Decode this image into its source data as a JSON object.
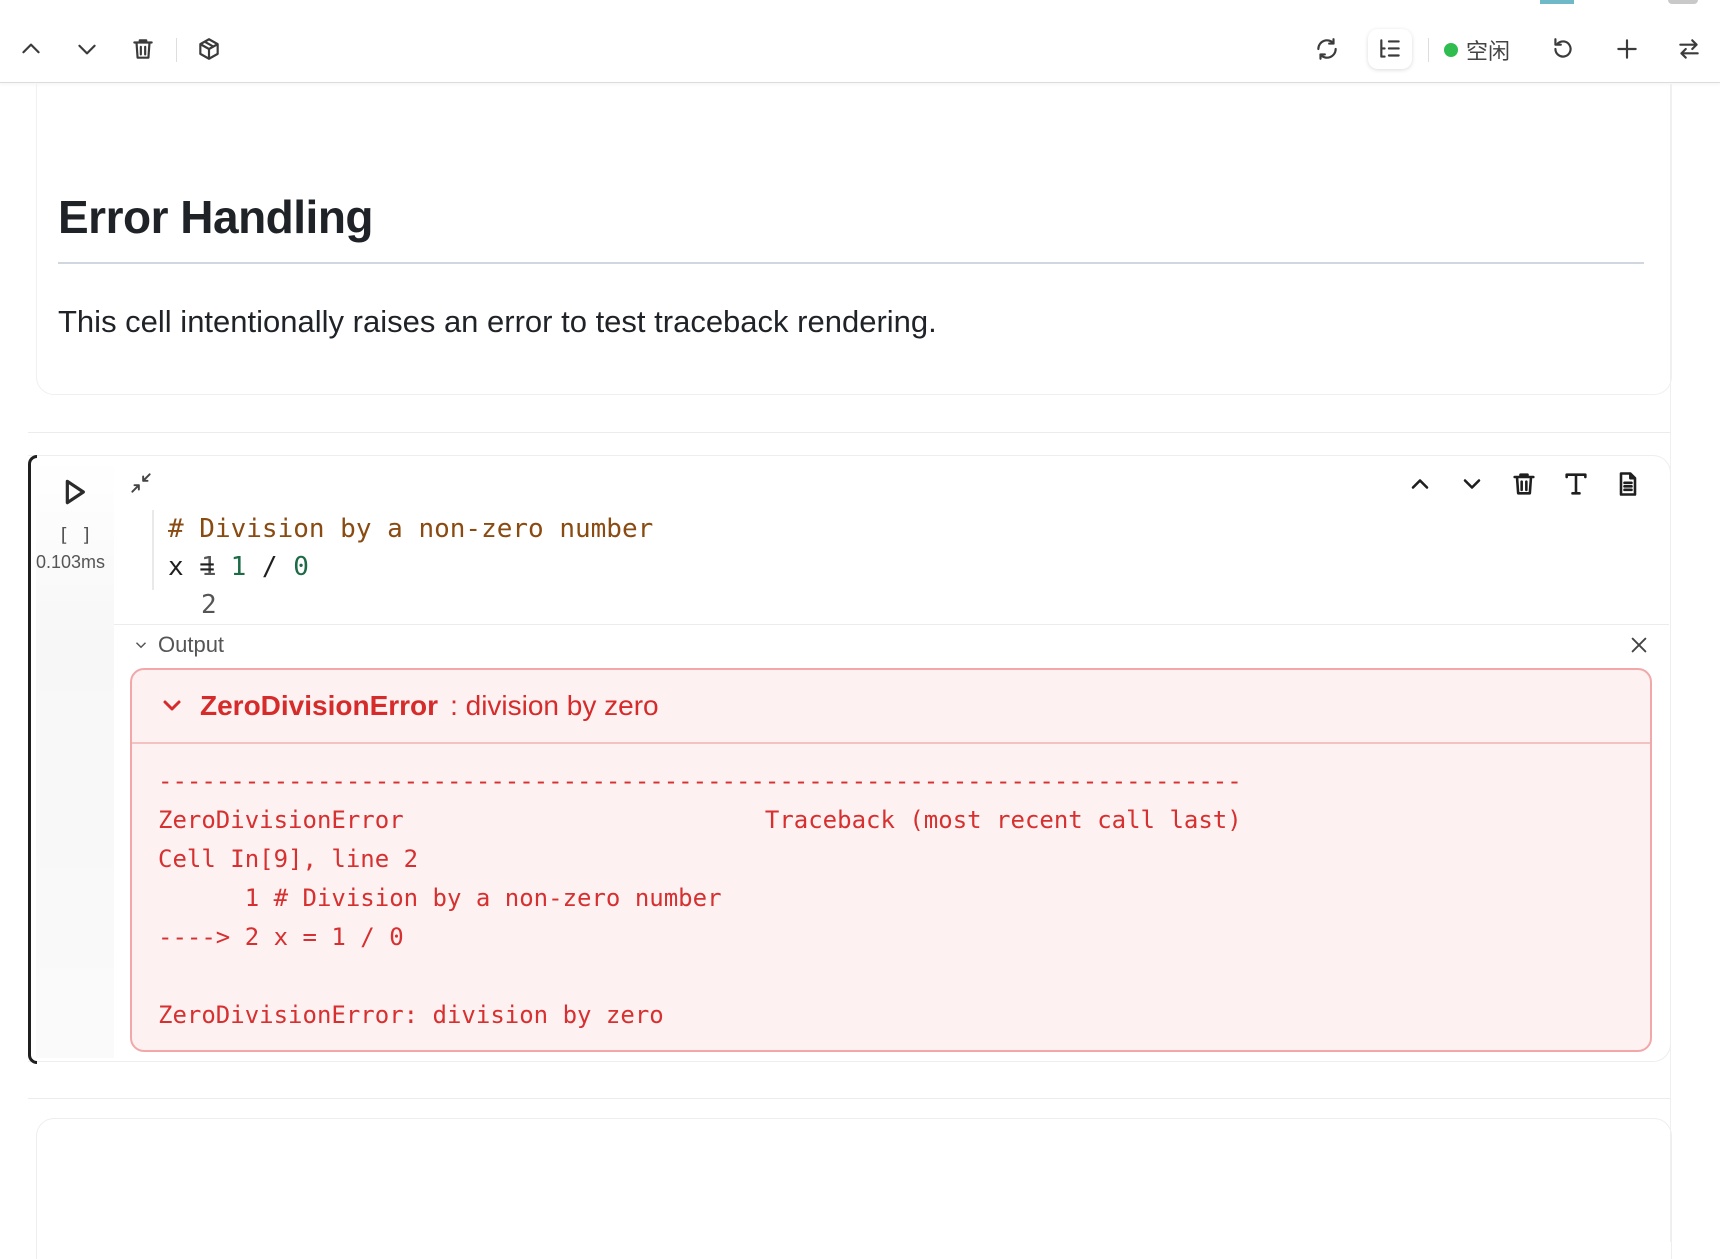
{
  "toolbar": {
    "kernel_status": "空闲",
    "kernel_status_color": "#2fbd50"
  },
  "markdown_cell": {
    "heading": "Error Handling",
    "paragraph": "This cell intentionally raises an error to test traceback rendering."
  },
  "code_cell": {
    "execution_count": "[ ]",
    "execution_time": "0.103ms",
    "lines": [
      {
        "number": "1",
        "comment": "# Division by a non-zero number"
      },
      {
        "number": "2",
        "code_var": "x = ",
        "code_num1": "1",
        "code_op": " / ",
        "code_num2": "0"
      }
    ]
  },
  "output": {
    "label": "Output",
    "error_name": "ZeroDivisionError",
    "error_message": ": division by zero",
    "error_color": "#d62b2b",
    "traceback": [
      "---------------------------------------------------------------------------",
      "ZeroDivisionError                         Traceback (most recent call last)",
      "Cell In[9], line 2",
      "      1 # Division by a non-zero number",
      "----> 2 x = 1 / 0",
      "",
      "ZeroDivisionError: division by zero"
    ]
  }
}
